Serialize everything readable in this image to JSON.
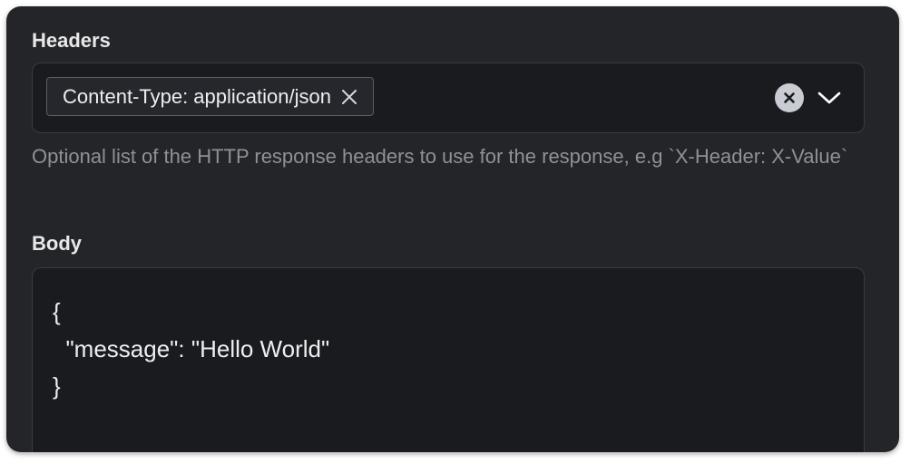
{
  "headers": {
    "label": "Headers",
    "chips": [
      {
        "text": "Content-Type: application/json"
      }
    ],
    "help_text": "Optional list of the HTTP response headers to use for the response, e.g `X-Header: X-Value`"
  },
  "body": {
    "label": "Body",
    "value": "{\n  \"message\": \"Hello World\"\n}"
  },
  "icons": {
    "chip_remove": "close-icon",
    "clear": "clear-circle-icon",
    "dropdown": "chevron-down-icon"
  },
  "colors": {
    "panel_bg": "#242529",
    "field_bg": "#1a1b1f",
    "text": "#eeeef0",
    "muted_text": "#8e9199",
    "clear_button": "#c9ccd2"
  }
}
